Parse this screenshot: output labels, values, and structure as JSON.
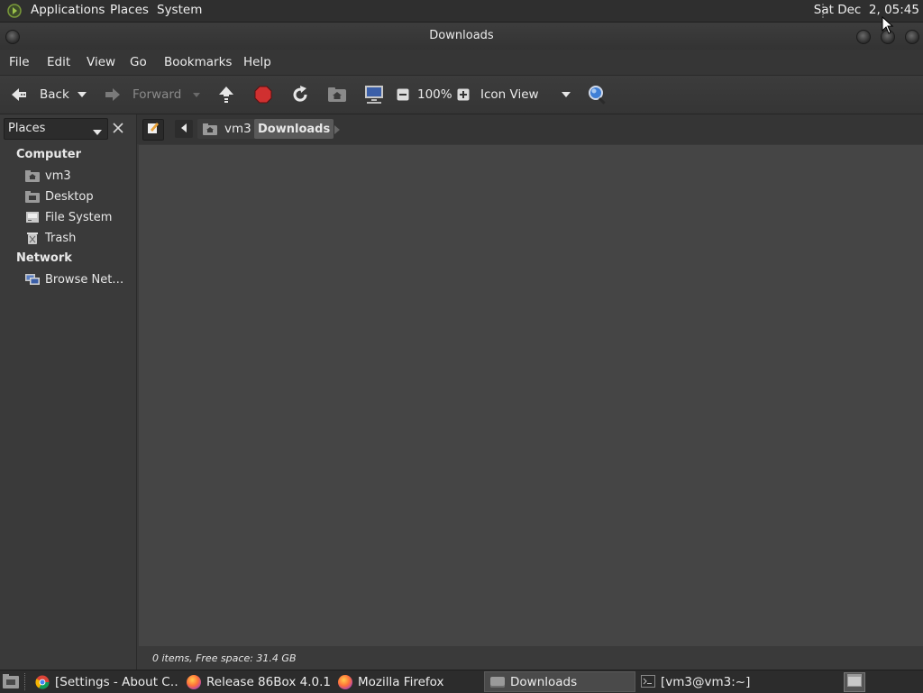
{
  "top_panel": {
    "menus": [
      "Applications",
      "Places",
      "System"
    ],
    "clock": "Sat Dec  2, 05:45"
  },
  "window": {
    "title": "Downloads"
  },
  "menubar": [
    "File",
    "Edit",
    "View",
    "Go",
    "Bookmarks",
    "Help"
  ],
  "toolbar": {
    "back_label": "Back",
    "forward_label": "Forward",
    "zoom_level": "100%",
    "view_mode": "Icon View"
  },
  "sidebar": {
    "selector_label": "Places",
    "sections": [
      {
        "heading": "Computer",
        "items": [
          "vm3",
          "Desktop",
          "File System",
          "Trash"
        ]
      },
      {
        "heading": "Network",
        "items": [
          "Browse Net…"
        ]
      }
    ]
  },
  "location": {
    "crumbs": [
      "vm3",
      "Downloads"
    ],
    "active_crumb": "Downloads"
  },
  "status": {
    "text": "0 items, Free space: 31.4 GB"
  },
  "taskbar": {
    "tasks": [
      {
        "label": "[Settings - About C…",
        "icon": "chrome-icon"
      },
      {
        "label": "Release 86Box 4.0.1 …",
        "icon": "firefox-icon"
      },
      {
        "label": "Mozilla Firefox",
        "icon": "firefox-icon"
      },
      {
        "label": "Downloads",
        "icon": "folder-icon",
        "active": true
      },
      {
        "label": "[vm3@vm3:~]",
        "icon": "terminal-icon"
      }
    ]
  },
  "colors": {
    "panel": "#2f2f2f",
    "window_bg": "#3a3a3a",
    "content_bg": "#454545",
    "stop_red": "#d03030",
    "search_blue": "#3f7fd6"
  }
}
